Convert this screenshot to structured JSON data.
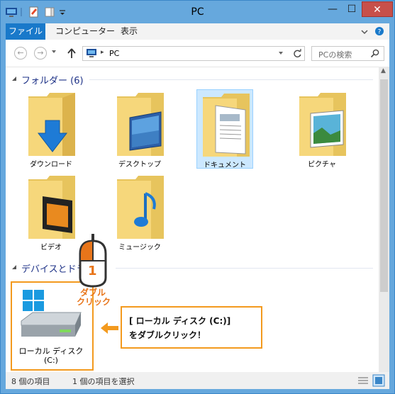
{
  "window": {
    "title": "PC"
  },
  "ribbon": {
    "file_tab": "ファイル",
    "tabs": [
      "コンピューター",
      "表示"
    ]
  },
  "address": {
    "location": "PC"
  },
  "search": {
    "placeholder": "PCの検索"
  },
  "groups": {
    "folders": {
      "header": "フォルダー (6)",
      "items": [
        "ダウンロード",
        "デスクトップ",
        "ドキュメント",
        "ピクチャ",
        "ビデオ",
        "ミュージック"
      ]
    },
    "devices": {
      "header": "デバイスとドラ"
    }
  },
  "drive": {
    "label_line1": "ローカル ディスク",
    "label_line2": "(C:)"
  },
  "status": {
    "count": "8 個の項目",
    "selected": "1 個の項目を選択"
  },
  "annotation": {
    "step": "1",
    "action_line1": "ダブル",
    "action_line2": "クリック",
    "callout_line1": "[ ローカル ディスク (C:)]",
    "callout_line2": "をダブルクリック！"
  },
  "colors": {
    "accent": "#1979ca",
    "highlight": "#f39a1e",
    "close": "#c7504a"
  },
  "icons": [
    "computer-icon",
    "properties-icon",
    "new-folder-icon",
    "customize-icon",
    "back-icon",
    "forward-icon",
    "up-arrow-icon",
    "refresh-icon",
    "search-icon",
    "folder-icon",
    "drive-icon",
    "mouse-icon",
    "arrow-left-icon"
  ]
}
